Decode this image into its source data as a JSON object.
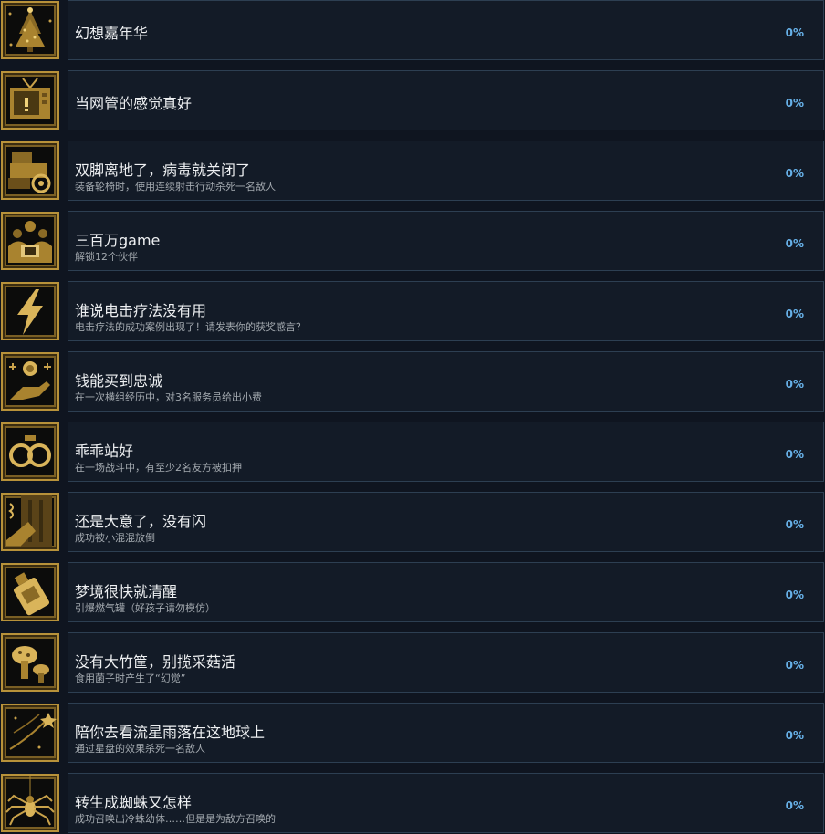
{
  "colors": {
    "background": "#0f1520",
    "panel": "#131b27",
    "panel_border": "#2d3f52",
    "icon_gold": "#c9a24a",
    "percent_blue": "#67b1e8"
  },
  "achievements": [
    {
      "icon": "christmas-tree-icon",
      "title": "幻想嘉年华",
      "description": "",
      "percent": "0%"
    },
    {
      "icon": "tv-icon",
      "title": "当网管的感觉真好",
      "description": "",
      "percent": "0%"
    },
    {
      "icon": "wheelchair-icon",
      "title": "双脚离地了，病毒就关闭了",
      "description": "装备轮椅时，使用连续射击行动杀死一名敌人",
      "percent": "0%"
    },
    {
      "icon": "crowd-icon",
      "title": "三百万game",
      "description": "解锁12个伙伴",
      "percent": "0%"
    },
    {
      "icon": "lightning-icon",
      "title": "谁说电击疗法没有用",
      "description": "电击疗法的成功案例出现了！请发表你的获奖感言？",
      "percent": "0%"
    },
    {
      "icon": "coin-hand-icon",
      "title": "钱能买到忠诚",
      "description": "在一次横组经历中，对3名服务员给出小费",
      "percent": "0%"
    },
    {
      "icon": "handcuffs-icon",
      "title": "乖乖站好",
      "description": "在一场战斗中，有至少2名友方被扣押",
      "percent": "0%"
    },
    {
      "icon": "knocked-down-icon",
      "title": "还是大意了，没有闪",
      "description": "成功被小混混放倒",
      "percent": "0%"
    },
    {
      "icon": "gas-can-icon",
      "title": "梦境很快就清醒",
      "description": "引爆燃气罐（好孩子请勿模仿）",
      "percent": "0%"
    },
    {
      "icon": "mushroom-icon",
      "title": "没有大竹筐，别揽采菇活",
      "description": "食用菌子时产生了“幻觉”",
      "percent": "0%"
    },
    {
      "icon": "shooting-star-icon",
      "title": "陪你去看流星雨落在这地球上",
      "description": "通过星盘的效果杀死一名敌人",
      "percent": "0%"
    },
    {
      "icon": "spider-icon",
      "title": "转生成蜘蛛又怎样",
      "description": "成功召唤出冷蛛幼体……但是是为敌方召唤的",
      "percent": "0%"
    }
  ]
}
